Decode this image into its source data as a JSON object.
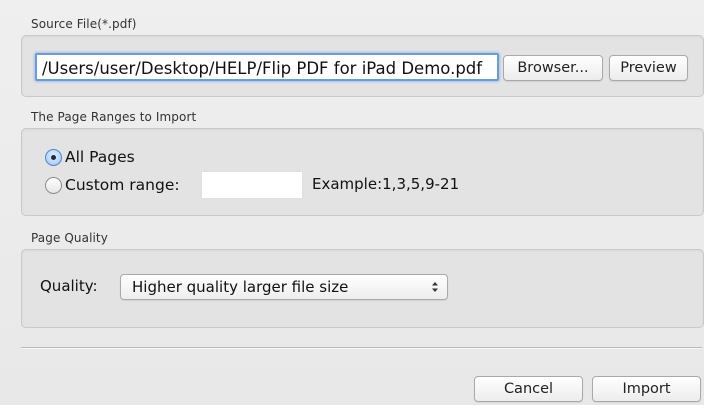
{
  "source_section": {
    "label": "Source File(*.pdf)",
    "path_value": "/Users/user/Desktop/HELP/Flip PDF for iPad Demo.pdf",
    "browse_label": "Browser...",
    "preview_label": "Preview"
  },
  "page_ranges": {
    "label": "The Page Ranges to Import",
    "all_pages_label": "All Pages",
    "all_pages_selected": true,
    "custom_range_label": "Custom range:",
    "custom_range_value": "",
    "example_text": "Example:1,3,5,9-21"
  },
  "page_quality": {
    "label": "Page Quality",
    "quality_label": "Quality:",
    "selected_option": "Higher quality larger file size"
  },
  "footer": {
    "cancel_label": "Cancel",
    "import_label": "Import"
  },
  "colors": {
    "focus_ring": "#6a9cdc",
    "background": "#ececec",
    "group_fill": "#e3e3e3"
  }
}
